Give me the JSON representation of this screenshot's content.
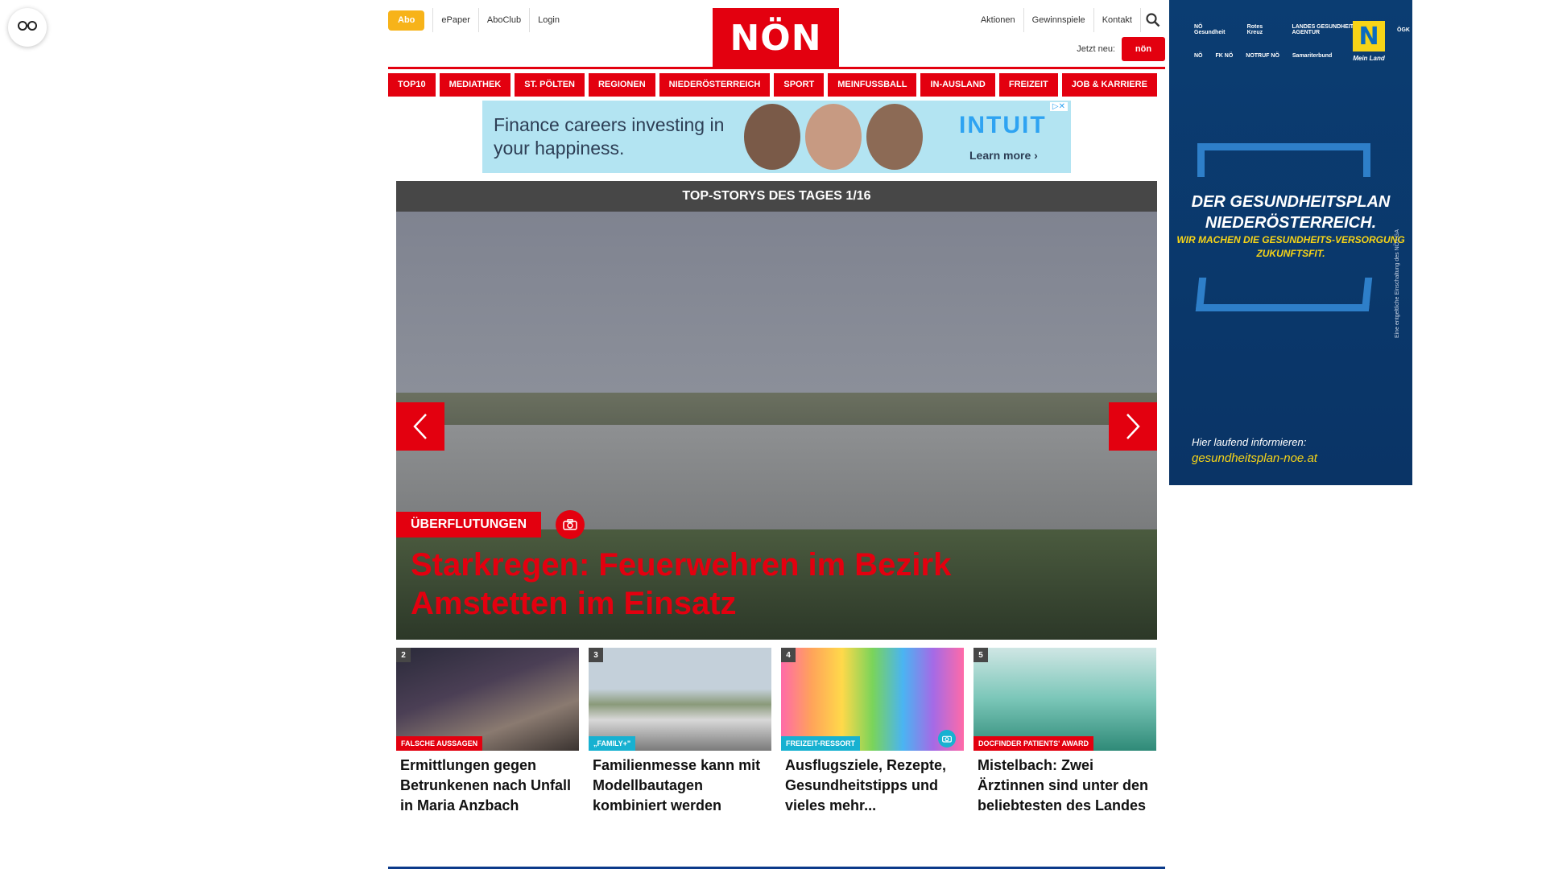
{
  "reader_button": {
    "icon": "glasses-icon"
  },
  "header": {
    "abo": "Abo",
    "toplinks": [
      "ePaper",
      "AboClub",
      "Login"
    ],
    "logo": "NÖN",
    "rightlinks": [
      "Aktionen",
      "Gewinnspiele",
      "Kontakt"
    ],
    "search_icon": "search-icon",
    "jetzt_label": "Jetzt neu:",
    "kleine_logo": "nön"
  },
  "nav": [
    "TOP10",
    "MEDIATHEK",
    "ST. PÖLTEN",
    "REGIONEN",
    "NIEDERÖSTERREICH",
    "SPORT",
    "MEINFUSSBALL",
    "IN-AUSLAND",
    "FREIZEIT",
    "JOB & KARRIERE"
  ],
  "ad": {
    "text": "Finance careers investing in your happiness.",
    "brand": "INTUIT",
    "cta": "Learn more ›",
    "close": "▷✕"
  },
  "hero": {
    "heading": "TOP-STORYS DES TAGES 1/16",
    "badge": "ÜBERFLUTUNGEN",
    "title": "Starkregen: Feuerwehren im Bezirk Amstetten im Einsatz"
  },
  "cards": [
    {
      "num": "2",
      "category": "FALSCHE AUSSAGEN",
      "title": "Ermittlungen gegen Betrunkenen nach Unfall in Maria Anzbach"
    },
    {
      "num": "3",
      "category": "„FAMILY+\"",
      "title": "Familienmesse kann mit Modellbautagen kombiniert werden"
    },
    {
      "num": "4",
      "category": "FREIZEIT-RESSORT",
      "title": "Ausflugsziele, Rezepte, Gesundheitstipps und vieles mehr..."
    },
    {
      "num": "5",
      "category": "DOCFINDER PATIENTS' AWARD",
      "title": "Mistelbach: Zwei Ärztinnen sind unter den beliebtesten des Landes"
    }
  ],
  "side_ad": {
    "headline": "DER GESUNDHEITSPLAN NIEDERÖSTERREICH.",
    "subline": "WIR MACHEN DIE GESUNDHEITS-VERSORGUNG ZUKUNFTSFIT.",
    "info": "Hier laufend informieren:",
    "url": "gesundheitsplan-noe.at",
    "meinland_label": "Mein Land",
    "disclaimer": "Eine entgeltliche Einschaltung des NÖ LGA",
    "partners_row1": [
      "NÖ Gesundheit",
      "Rotes Kreuz",
      "LANDES GESUNDHEITS AGENTUR",
      "ÖGK"
    ],
    "partners_row2": [
      "NÖ",
      "FK NÖ",
      "NOTRUF NÖ",
      "Samariterbund"
    ]
  },
  "colors": {
    "brand_red": "#e3000f",
    "abo_yellow": "#f7b319",
    "dark_gray": "#474747",
    "side_ad_blue": "#0b3d72",
    "accent_yellow": "#f7d417",
    "teal": "#17b1d1"
  }
}
